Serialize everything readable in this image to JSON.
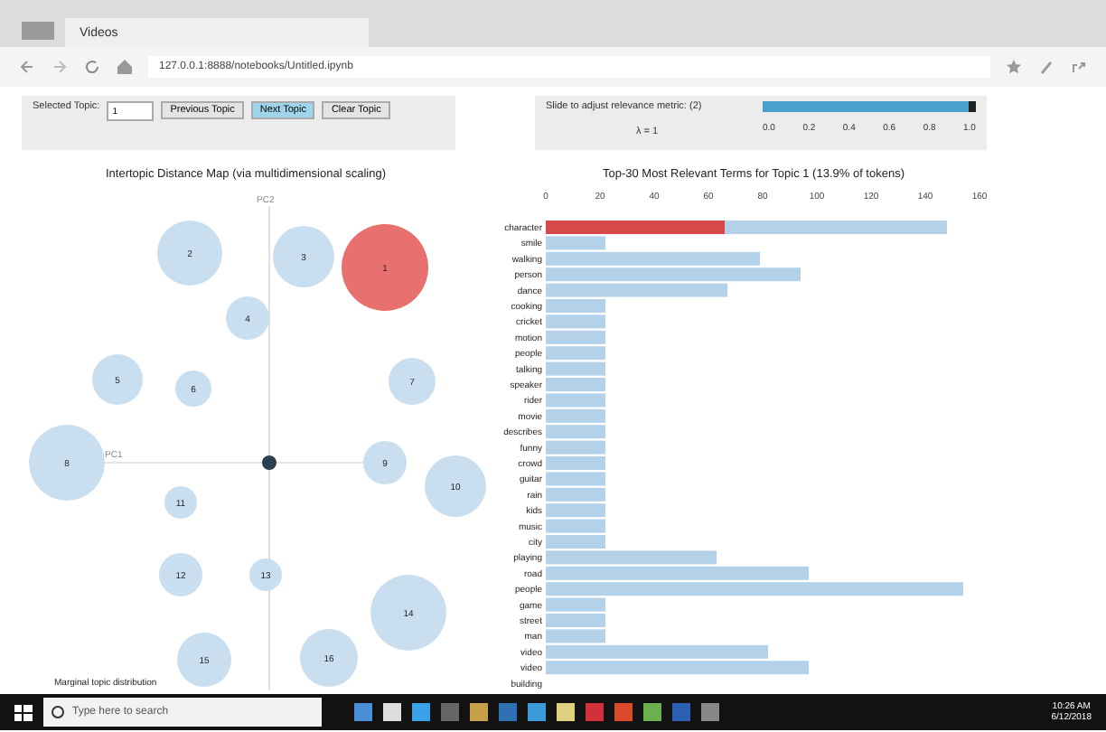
{
  "browser": {
    "tab_title": "Videos",
    "url": "127.0.0.1:8888/notebooks/Untitled.ipynb"
  },
  "controls": {
    "selected_topic_label": "Selected Topic:",
    "selected_topic_value": "1",
    "buttons": [
      {
        "label": "Previous Topic",
        "selected": false
      },
      {
        "label": "Next Topic",
        "selected": true
      },
      {
        "label": "Clear Topic",
        "selected": false
      }
    ],
    "slider_label": "Slide to adjust relevance metric: (2)",
    "lambda_text": "λ = 1",
    "level": 1,
    "ticks": [
      "0.0",
      "0.2",
      "0.4",
      "0.6",
      "0.8",
      "1.0"
    ]
  },
  "map": {
    "title": "Intertopic Distance Map (via multidimensional scaling)",
    "pc1": "PC1",
    "pc2": "PC2",
    "footer": "Marginal topic distribution",
    "topics": [
      {
        "label": "2",
        "selected": false
      },
      {
        "label": "3",
        "selected": false
      },
      {
        "label": "1",
        "selected": true
      },
      {
        "label": "4",
        "selected": false
      },
      {
        "label": "5",
        "selected": false
      },
      {
        "label": "6",
        "selected": false
      },
      {
        "label": "7",
        "selected": false
      },
      {
        "label": "8",
        "selected": false
      },
      {
        "label": "9",
        "selected": false
      },
      {
        "label": "10",
        "selected": false
      },
      {
        "label": "11",
        "selected": false
      },
      {
        "label": "12",
        "selected": false
      },
      {
        "label": "13",
        "selected": false
      },
      {
        "label": "14",
        "selected": false
      },
      {
        "label": "15",
        "selected": false
      },
      {
        "label": "16",
        "selected": false
      }
    ]
  },
  "terms": {
    "chart_data": {
      "type": "bar",
      "orientation": "horizontal",
      "title": "Top-30 Most Relevant Terms for Topic 1 (13.9% of tokens)",
      "xticks": [
        0,
        20,
        40,
        60,
        80,
        100,
        120,
        140,
        160
      ],
      "xlim": [
        0,
        160
      ],
      "categories": [
        "character",
        "smile",
        "walking",
        "person",
        "dance",
        "cooking",
        "cricket",
        "motion",
        "people",
        "talking",
        "speaker",
        "rider",
        "movie",
        "describes",
        "funny",
        "crowd",
        "guitar",
        "rain",
        "kids",
        "music",
        "city",
        "playing",
        "road",
        "people",
        "game",
        "street",
        "man",
        "video",
        "video",
        "building"
      ],
      "series": [
        {
          "color": "#b3d1e9",
          "values": [
            148,
            22,
            79,
            94,
            67,
            22,
            22,
            22,
            22,
            22,
            22,
            22,
            22,
            22,
            22,
            22,
            22,
            22,
            22,
            22,
            22,
            63,
            97,
            154,
            22,
            22,
            22,
            82,
            97,
            null
          ]
        },
        {
          "color": "#d6494b",
          "values": [
            66,
            null,
            null,
            null,
            null,
            null,
            null,
            null,
            null,
            null,
            null,
            null,
            null,
            null,
            null,
            null,
            null,
            null,
            null,
            null,
            null,
            null,
            null,
            null,
            null,
            null,
            null,
            null,
            null,
            null
          ]
        }
      ]
    }
  },
  "taskbar": {
    "search_placeholder": "Type here to search",
    "time": "10:26 AM",
    "date": "6/12/2018"
  }
}
